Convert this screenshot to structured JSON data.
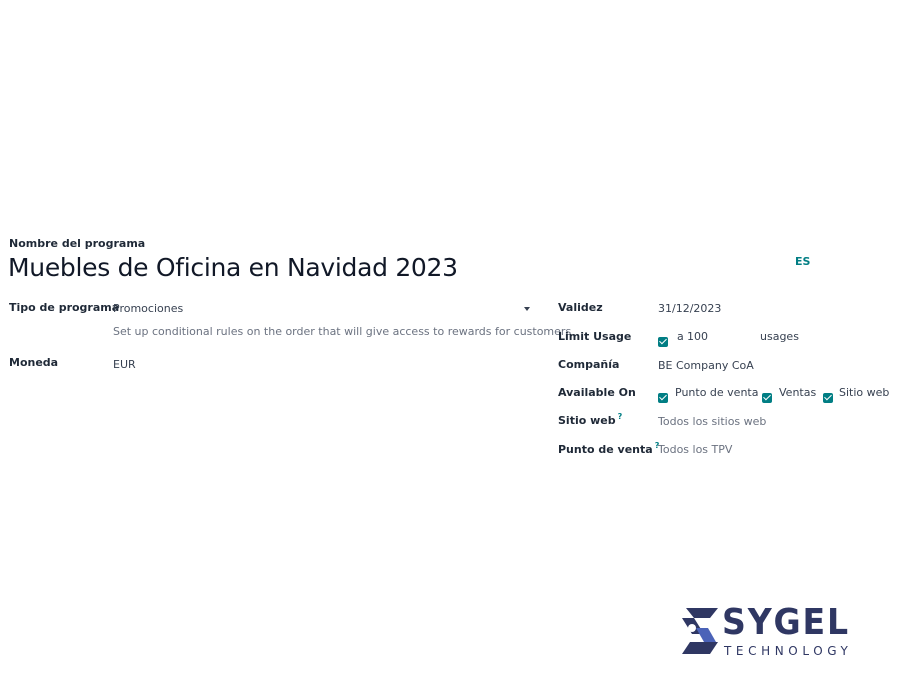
{
  "header": {
    "field_label": "Nombre del programa",
    "program_name": "Muebles de Oficina en Navidad 2023",
    "language_badge": "ES"
  },
  "left": {
    "program_type_label": "Tipo de programa",
    "program_type_value": "Promociones",
    "program_type_help": "Set up conditional rules on the order that will give access to rewards for customers",
    "currency_label": "Moneda",
    "currency_value": "EUR"
  },
  "right": {
    "validity_label": "Validez",
    "validity_value": "31/12/2023",
    "limit_label": "Limit Usage",
    "limit_checked": true,
    "limit_prefix": "a",
    "limit_value": "100",
    "limit_suffix": "usages",
    "company_label": "Compañía",
    "company_value": "BE Company CoA",
    "available_label": "Available On",
    "available_options": [
      {
        "label": "Punto de venta",
        "checked": true
      },
      {
        "label": "Ventas",
        "checked": true
      },
      {
        "label": "Sitio web",
        "checked": true
      }
    ],
    "website_label": "Sitio web",
    "website_help_mark": "?",
    "website_value": "Todos los sitios web",
    "pos_label": "Punto de venta",
    "pos_help_mark": "?",
    "pos_value": "Todos los TPV"
  },
  "logo": {
    "word": "SYGEL",
    "sub": "TECHNOLOGY"
  },
  "colors": {
    "accent": "#017e84",
    "logo": "#2f3763",
    "logo_light": "#4b63b8"
  }
}
